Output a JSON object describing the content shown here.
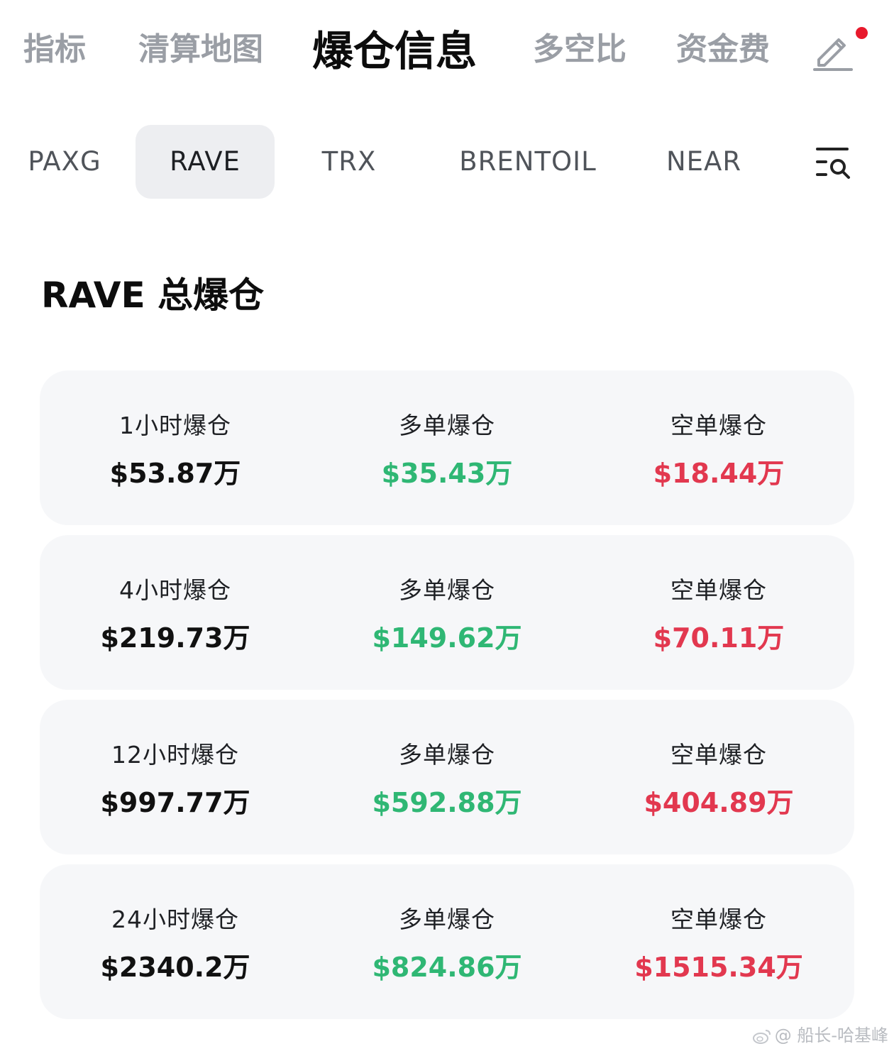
{
  "top_tabs": [
    {
      "label": "指标",
      "active": false
    },
    {
      "label": "清算地图",
      "active": false
    },
    {
      "label": "爆仓信息",
      "active": true
    },
    {
      "label": "多空比",
      "active": false
    },
    {
      "label": "资金费",
      "active": false
    }
  ],
  "notification_dot_color": "#e8192c",
  "symbols": [
    {
      "label": "PAXG",
      "active": false
    },
    {
      "label": "RAVE",
      "active": true
    },
    {
      "label": "TRX",
      "active": false
    },
    {
      "label": "BRENTOIL",
      "active": false
    },
    {
      "label": "NEAR",
      "active": false
    }
  ],
  "section_title": "RAVE 总爆仓",
  "colors": {
    "long": "#2fb774",
    "short": "#e2384f",
    "card_bg": "#f6f7f9",
    "inactive_tab": "#9a9ea5"
  },
  "cards": [
    {
      "total_label": "1小时爆仓",
      "total_value": "$53.87万",
      "long_label": "多单爆仓",
      "long_value": "$35.43万",
      "short_label": "空单爆仓",
      "short_value": "$18.44万"
    },
    {
      "total_label": "4小时爆仓",
      "total_value": "$219.73万",
      "long_label": "多单爆仓",
      "long_value": "$149.62万",
      "short_label": "空单爆仓",
      "short_value": "$70.11万"
    },
    {
      "total_label": "12小时爆仓",
      "total_value": "$997.77万",
      "long_label": "多单爆仓",
      "long_value": "$592.88万",
      "short_label": "空单爆仓",
      "short_value": "$404.89万"
    },
    {
      "total_label": "24小时爆仓",
      "total_value": "$2340.2万",
      "long_label": "多单爆仓",
      "long_value": "$824.86万",
      "short_label": "空单爆仓",
      "short_value": "$1515.34万"
    }
  ],
  "watermark": "@ 船长-哈基峰",
  "icons": {
    "edit": "pencil-edit-icon",
    "filter": "list-search-icon",
    "watermark": "weibo-logo-icon"
  }
}
